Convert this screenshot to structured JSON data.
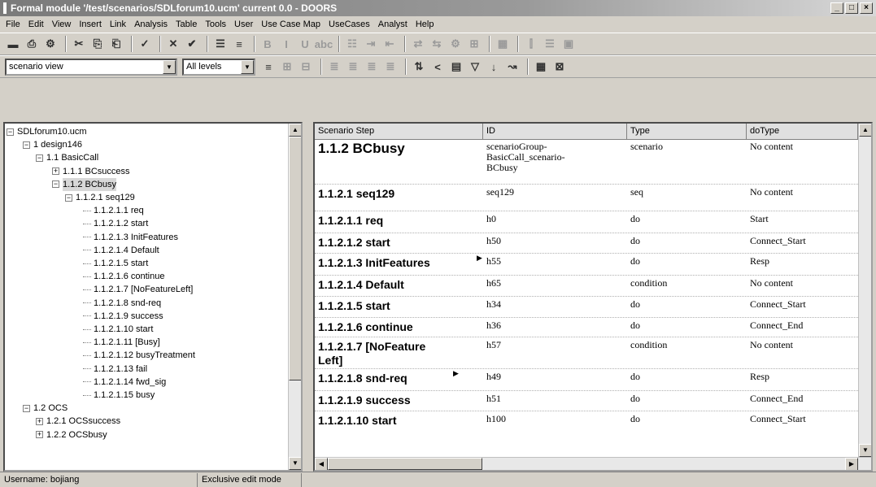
{
  "window": {
    "title": "Formal module '/test/scenarios/SDLforum10.ucm' current 0.0 - DOORS",
    "controls": [
      "_",
      "□",
      "×"
    ]
  },
  "menu": [
    "File",
    "Edit",
    "View",
    "Insert",
    "Link",
    "Analysis",
    "Table",
    "Tools",
    "User",
    "Use Case Map",
    "UseCases",
    "Analyst",
    "Help"
  ],
  "toolbar1": {
    "icons": [
      "save-icon",
      "print-icon",
      "properties-icon",
      "cut-icon",
      "copy-icon",
      "paste-icon",
      "spellcheck-icon",
      "delete-icon",
      "check-icon",
      "align-icon",
      "format-icon",
      "bold-icon",
      "italic-icon",
      "underline-icon",
      "strikethrough-icon",
      "bullet-list-icon",
      "indent-icon",
      "outdent-icon",
      "link-icon",
      "link-module-icon",
      "properties-icon",
      "filter-icon",
      "table-icon",
      "insert-column-icon",
      "insert-row-icon",
      "picture-icon"
    ],
    "glyphs": [
      "▬",
      "⎙",
      "⚙",
      "✂",
      "⎘",
      "⎗",
      "✓",
      "✕",
      "✔",
      "☰",
      "≡",
      "B",
      "I",
      "U",
      "abc",
      "☷",
      "⇥",
      "⇤",
      "⇄",
      "⇆",
      "⚙",
      "⊞",
      "▦",
      "⫿",
      "☰",
      "▣"
    ]
  },
  "toolbar2": {
    "view_value": "scenario view",
    "level_value": "All levels",
    "icons": [
      "outline-icon",
      "expand-icon",
      "collapse-icon",
      "align-left-icon",
      "align-center-icon",
      "align-right-icon",
      "justify-icon",
      "sort-icon",
      "links-icon",
      "graphics-icon",
      "filter-icon",
      "sort-ascending-icon",
      "link-arrow-icon",
      "module-icon",
      "baseline-icon"
    ],
    "glyphs": [
      "≡",
      "⊞",
      "⊟",
      "≣",
      "≣",
      "≣",
      "≣",
      "⇅",
      "<",
      "▤",
      "▽",
      "↓",
      "↝",
      "▦",
      "⊠"
    ]
  },
  "tree": [
    {
      "label": "SDLforum10.ucm",
      "depth": 0,
      "exp": "⊟"
    },
    {
      "label": "1 design146",
      "depth": 1,
      "exp": "⊟"
    },
    {
      "label": "1.1 BasicCall",
      "depth": 2,
      "exp": "⊟"
    },
    {
      "label": "1.1.1 BCsuccess",
      "depth": 3,
      "exp": "⊞"
    },
    {
      "label": "1.1.2 BCbusy",
      "depth": 3,
      "exp": "⊟",
      "selected": true
    },
    {
      "label": "1.1.2.1 seq129",
      "depth": 4,
      "exp": "⊟"
    },
    {
      "label": "1.1.2.1.1 req",
      "depth": 5
    },
    {
      "label": "1.1.2.1.2 start",
      "depth": 5
    },
    {
      "label": "1.1.2.1.3 InitFeatures",
      "depth": 5
    },
    {
      "label": "1.1.2.1.4 Default",
      "depth": 5
    },
    {
      "label": "1.1.2.1.5 start",
      "depth": 5
    },
    {
      "label": "1.1.2.1.6 continue",
      "depth": 5
    },
    {
      "label": "1.1.2.1.7 [NoFeatureLeft]",
      "depth": 5
    },
    {
      "label": "1.1.2.1.8 snd-req",
      "depth": 5
    },
    {
      "label": "1.1.2.1.9 success",
      "depth": 5
    },
    {
      "label": "1.1.2.1.10 start",
      "depth": 5
    },
    {
      "label": "1.1.2.1.11 [Busy]",
      "depth": 5
    },
    {
      "label": "1.1.2.1.12 busyTreatment",
      "depth": 5
    },
    {
      "label": "1.1.2.1.13 fail",
      "depth": 5
    },
    {
      "label": "1.1.2.1.14 fwd_sig",
      "depth": 5
    },
    {
      "label": "1.1.2.1.15 busy",
      "depth": 5
    },
    {
      "label": "1.2 OCS",
      "depth": 1,
      "exp": "⊟"
    },
    {
      "label": "1.2.1 OCSsuccess",
      "depth": 2,
      "exp": "⊞"
    },
    {
      "label": "1.2.2 OCSbusy",
      "depth": 2,
      "exp": "⊞"
    }
  ],
  "table": {
    "columns": [
      "Scenario Step",
      "ID",
      "Type",
      "doType"
    ],
    "rows": [
      {
        "step": "1.1.2 BCbusy",
        "id": "scenarioGroup-\nBasicCall_scenario-\nBCbusy",
        "type": "scenario",
        "dotype": "No content",
        "big": true
      },
      {
        "step": "1.1.2.1 seq129",
        "id": "seq129",
        "type": "seq",
        "dotype": "No content"
      },
      {
        "step": "1.1.2.1.1 req",
        "id": "h0",
        "type": "do",
        "dotype": "Start"
      },
      {
        "step": "1.1.2.1.2 start",
        "id": "h50",
        "type": "do",
        "dotype": "Connect_Start"
      },
      {
        "step": "1.1.2.1.3 InitFeatures",
        "id": "h55",
        "type": "do",
        "dotype": "Resp",
        "flag": true
      },
      {
        "step": "1.1.2.1.4 Default",
        "id": "h65",
        "type": "condition",
        "dotype": "No content"
      },
      {
        "step": "1.1.2.1.5 start",
        "id": "h34",
        "type": "do",
        "dotype": "Connect_Start"
      },
      {
        "step": "1.1.2.1.6 continue",
        "id": "h36",
        "type": "do",
        "dotype": "Connect_End"
      },
      {
        "step": "1.1.2.1.7 [NoFeature\n          Left]",
        "id": "h57",
        "type": "condition",
        "dotype": "No content"
      },
      {
        "step": "1.1.2.1.8 snd-req",
        "id": "h49",
        "type": "do",
        "dotype": "Resp",
        "flag": true
      },
      {
        "step": "1.1.2.1.9 success",
        "id": "h51",
        "type": "do",
        "dotype": "Connect_End"
      },
      {
        "step": "1.1.2.1.10 start",
        "id": "h100",
        "type": "do",
        "dotype": "Connect_Start"
      }
    ]
  },
  "status": {
    "username": "Username: bojiang",
    "mode": "Exclusive edit mode"
  }
}
